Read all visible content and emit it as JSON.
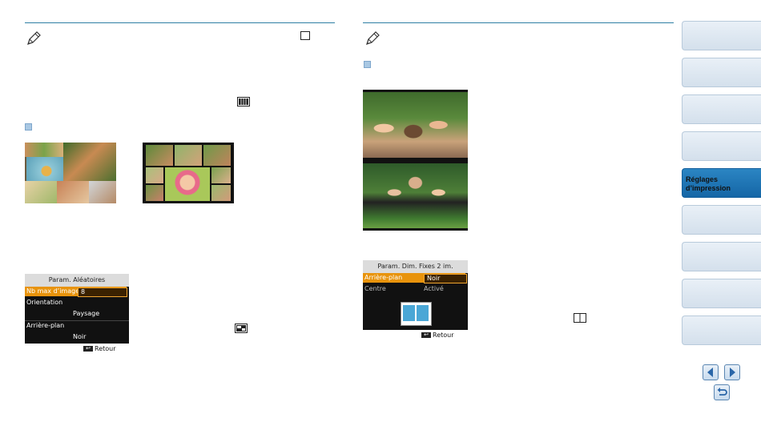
{
  "left_panel": {
    "random_screen": {
      "title": "Param. Aléatoires",
      "rows": [
        {
          "label": "Nb max d’images",
          "value": "8"
        },
        {
          "label": "Orientation",
          "value": "Paysage"
        },
        {
          "label": "Arrière-plan",
          "value": "Noir"
        }
      ],
      "footer": "Retour"
    }
  },
  "right_panel": {
    "fixed_screen": {
      "title": "Param. Dim. Fixes 2 im.",
      "rows": [
        {
          "label": "Arrière-plan",
          "value": "Noir"
        },
        {
          "label": "Centre",
          "value": "Activé"
        }
      ],
      "footer": "Retour"
    }
  },
  "sidebar": {
    "tabs": [
      {
        "label": ""
      },
      {
        "label": ""
      },
      {
        "label": ""
      },
      {
        "label": ""
      },
      {
        "label_line1": "Réglages",
        "label_line2": "d’impression",
        "active": true
      },
      {
        "label": ""
      },
      {
        "label": ""
      },
      {
        "label": ""
      },
      {
        "label": ""
      }
    ]
  },
  "colors": {
    "rule": "#2f7fa4",
    "active_tab": "#1a70b0",
    "highlight": "#e8930c"
  },
  "icons": [
    "pencil-note-icon",
    "grid-layout-icon",
    "collage-icon",
    "two-frame-icon",
    "arrow-left-icon",
    "arrow-right-icon",
    "return-icon"
  ]
}
